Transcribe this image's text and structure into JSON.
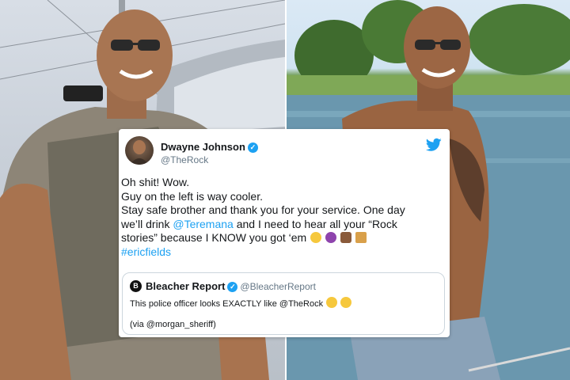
{
  "images": {
    "left": {
      "alt": "police officer"
    },
    "right": {
      "alt": "Dwayne Johnson"
    }
  },
  "tweet": {
    "author_name": "Dwayne Johnson",
    "author_handle": "@TheRock",
    "verified_mark": "✓",
    "lines": {
      "l1": "Oh shit! Wow.",
      "l2": "Guy on the left is way cooler.",
      "l3": "Stay safe brother and thank you for your service. One day",
      "l4a": "we’ll drink ",
      "l4_mention": "@Teremana",
      "l4b": " and I need to hear all your “Rock",
      "l5": "stories” because I KNOW you got ‘em",
      "l6_hashtag": "#ericfields"
    },
    "emojis": [
      "laughing-emoji",
      "devil-emoji",
      "fist-emoji",
      "whiskey-glass-emoji"
    ],
    "quote": {
      "logo_letter": "B",
      "name": "Bleacher Report",
      "handle": "@BleacherReport",
      "text": "This police officer looks EXACTLY like @TheRock",
      "emojis": [
        "flushed-emoji",
        "laughing-emoji"
      ],
      "via": "(via @morgan_sheriff)"
    }
  },
  "colors": {
    "accent": "#1da1f2",
    "text": "#14171a",
    "muted": "#657786"
  }
}
